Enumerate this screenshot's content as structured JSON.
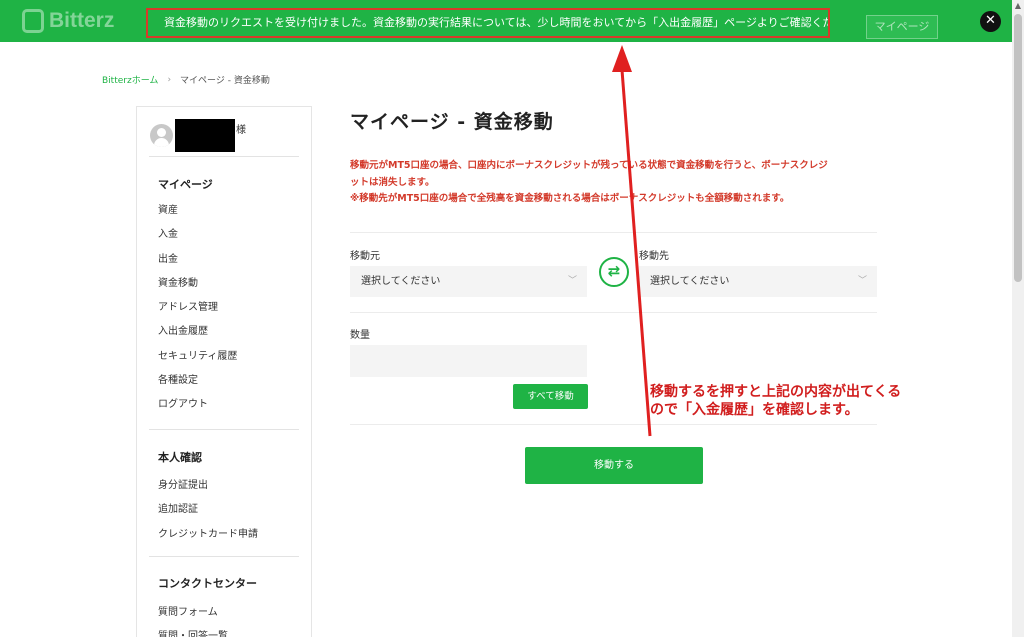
{
  "header": {
    "brand": "Bitterz",
    "notice": "資金移動のリクエストを受け付けました。資金移動の実行結果については、少し時間をおいてから「入出金履歴」ページよりご確認ください。",
    "mypage_button": "マイページ",
    "close_icon": "close-icon",
    "notice_border_color": "#d63a2a",
    "accent_color": "#1fb345"
  },
  "breadcrumb": {
    "home": "Bitterzホーム",
    "current": "マイページ - 資金移動"
  },
  "sidebar": {
    "user_suffix": "様",
    "sections": [
      {
        "heading": "マイページ",
        "items": [
          "資産",
          "入金",
          "出金",
          "資金移動",
          "アドレス管理",
          "入出金履歴",
          "セキュリティ履歴",
          "各種設定",
          "ログアウト"
        ]
      },
      {
        "heading": "本人確認",
        "items": [
          "身分証提出",
          "追加認証",
          "クレジットカード申請"
        ]
      },
      {
        "heading": "コンタクトセンター",
        "items": [
          "質問フォーム",
          "質問・回答一覧"
        ]
      }
    ]
  },
  "main": {
    "title": "マイページ - 資金移動",
    "warning_line1": "移動元がMT5口座の場合、口座内にボーナスクレジットが残っている状態で資金移動を行うと、ボーナスクレジ",
    "warning_line2": "ットは消失します。",
    "warning_line3": "※移動先がMT5口座の場合で全残高を資金移動される場合はボーナスクレジットも全額移動されます。",
    "from_label": "移動元",
    "from_value": "選択してください",
    "to_label": "移動先",
    "to_value": "選択してください",
    "amount_label": "数量",
    "amount_value": "",
    "all_button": "すべて移動",
    "submit_button": "移動する",
    "swap_icon": "swap-arrows-icon"
  },
  "annotation": {
    "line1": "移動するを押すと上記の内容が出てくる",
    "line2": "ので「入金履歴」を確認します。",
    "color": "#d11e1e"
  }
}
